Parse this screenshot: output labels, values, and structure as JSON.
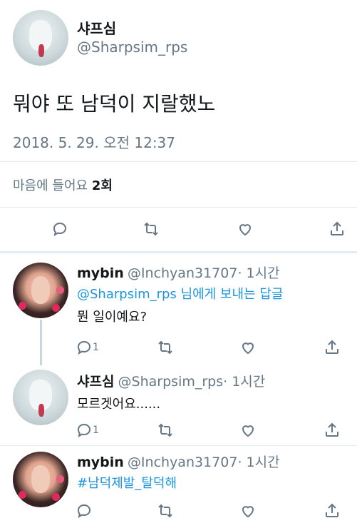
{
  "tweet": {
    "display_name": "샤프심",
    "handle": "@Sharpsim_rps",
    "text": "뭐야 또 남덕이 지랄했노",
    "timestamp": "2018. 5. 29. 오전 12:37",
    "likes_prefix": "마음에 들어요",
    "likes_count": "2회",
    "actions": [
      "reply-icon",
      "retweet-icon",
      "like-icon",
      "share-icon"
    ]
  },
  "replies": [
    {
      "display_name": "mybin",
      "handle": "@Inchyan31707",
      "time": "· 1시간",
      "reply_to_handle": "@Sharpsim_rps",
      "reply_to_suffix": " 님에게 보내는 답글",
      "text": "뭔 일이예요?",
      "reply_count": "1"
    },
    {
      "display_name": "샤프심",
      "handle": "@Sharpsim_rps",
      "time": "· 1시간",
      "text": "모르겟어요......",
      "reply_count": "1"
    },
    {
      "display_name": "mybin",
      "handle": "@Inchyan31707",
      "time": "· 1시간",
      "hashtag": "#남덕제발_탈덕해"
    }
  ],
  "colors": {
    "link": "#1b95e0",
    "muted": "#657786",
    "text": "#14171a",
    "divider": "#e6ecf0"
  }
}
